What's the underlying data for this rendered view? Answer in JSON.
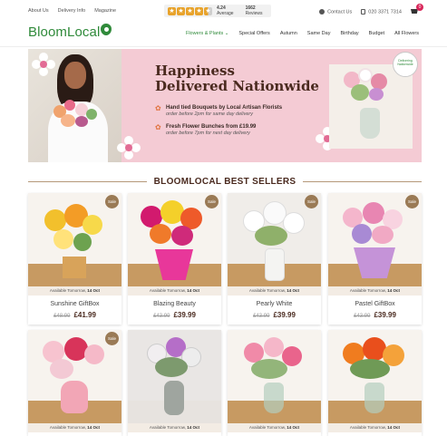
{
  "topbar": {
    "links": [
      "About Us",
      "Delivery Info",
      "Magazine"
    ],
    "rating_value": "4.24",
    "rating_label": "Average",
    "reviews_count": "1662",
    "reviews_label": "Reviews",
    "contact_label": "Contact Us",
    "phone": "020 3371 7314",
    "cart_count": "0"
  },
  "header": {
    "logo": "BloomLocal",
    "nav": [
      "Flowers & Plants",
      "Special Offers",
      "Autumn",
      "Same Day",
      "Birthday",
      "Budget",
      "All Flowers"
    ]
  },
  "hero": {
    "title_line1": "Happiness",
    "title_line2": "Delivered Nationwide",
    "items": [
      {
        "title": "Hand tied Bouquets by Local Artisan Florists",
        "sub": "order before 2pm for same day delivery"
      },
      {
        "title": "Fresh Flower Bunches from £19.99",
        "sub": "order before 7pm for next day delivery"
      }
    ],
    "badge_text": "Delivering Nationwide"
  },
  "section_title": "BLOOMLOCAL BEST SELLERS",
  "sale_label": "Sale",
  "availability_prefix": "Available Tomorrow,",
  "availability_date": "14 Oct",
  "products": [
    {
      "name": "Sunshine GiftBox",
      "old_price": "£48.99",
      "price": "£41.99",
      "sale": true
    },
    {
      "name": "Blazing Beauty",
      "old_price": "£43.99",
      "price": "£39.99",
      "sale": true
    },
    {
      "name": "Pearly White",
      "old_price": "£43.99",
      "price": "£39.99",
      "sale": true
    },
    {
      "name": "Pastel GiftBox",
      "old_price": "£43.99",
      "price": "£39.99",
      "sale": true
    },
    {
      "name": "",
      "old_price": "",
      "price": "",
      "sale": true
    },
    {
      "name": "",
      "old_price": "",
      "price": "",
      "sale": false
    },
    {
      "name": "",
      "old_price": "",
      "price": "",
      "sale": false
    },
    {
      "name": "",
      "old_price": "",
      "price": "",
      "sale": false
    }
  ],
  "colors": {
    "brand_green": "#2f8a3a",
    "hero_pink": "#f4cbd4",
    "heading_brown": "#4a2a1f",
    "sale_badge": "#9a7a55",
    "cart_badge": "#d8265a"
  }
}
